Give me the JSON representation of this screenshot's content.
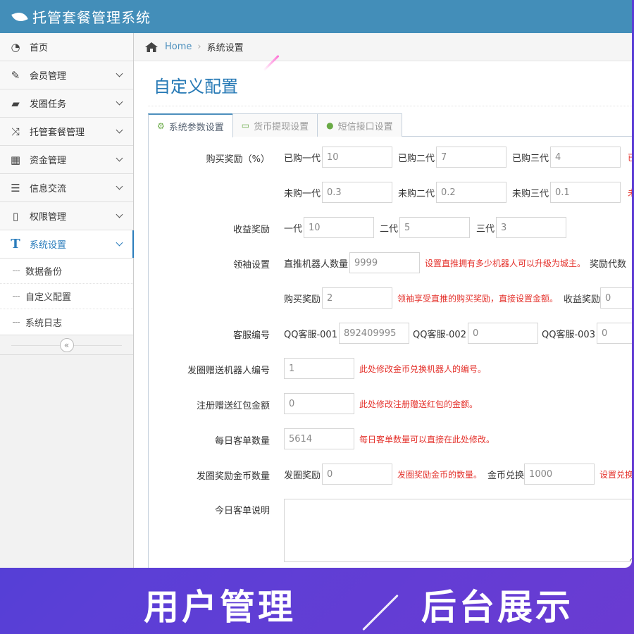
{
  "app": {
    "title": "托管套餐管理系统"
  },
  "sidebar": {
    "items": [
      {
        "label": "首页",
        "icon": "dashboard-icon",
        "glyph": "◔"
      },
      {
        "label": "会员管理",
        "icon": "edit-icon",
        "glyph": "✎"
      },
      {
        "label": "发圈任务",
        "icon": "book-icon",
        "glyph": "▰"
      },
      {
        "label": "托管套餐管理",
        "icon": "shuffle-icon",
        "glyph": "⤨"
      },
      {
        "label": "资金管理",
        "icon": "calendar-icon",
        "glyph": "▦"
      },
      {
        "label": "信息交流",
        "icon": "list-icon",
        "glyph": "☰"
      },
      {
        "label": "权限管理",
        "icon": "file-icon",
        "glyph": "▯"
      },
      {
        "label": "系统设置",
        "icon": "text-icon",
        "glyph": "T"
      }
    ],
    "sub_items": [
      "数据备份",
      "自定义配置",
      "系统日志"
    ],
    "collapse_glyph": "«"
  },
  "breadcrumb": {
    "home": "Home",
    "sep": "›",
    "current": "系统设置"
  },
  "page": {
    "title": "自定义配置"
  },
  "tabs": [
    {
      "label": "系统参数设置",
      "glyph": "⚙"
    },
    {
      "label": "货币提现设置",
      "glyph": "▭"
    },
    {
      "label": "短信接口设置",
      "glyph": "●"
    }
  ],
  "form": {
    "buy_reward": {
      "label": "购买奖励（%）",
      "bought": [
        {
          "prefix": "已购一代",
          "value": "10"
        },
        {
          "prefix": "已购二代",
          "value": "7"
        },
        {
          "prefix": "已购三代",
          "value": "4"
        }
      ],
      "not_bought": [
        {
          "prefix": "未购一代",
          "value": "0.3"
        },
        {
          "prefix": "未购二代",
          "value": "0.2"
        },
        {
          "prefix": "未购三代",
          "value": "0.1"
        }
      ],
      "cut_a": "已",
      "cut_b": "未"
    },
    "income_reward": {
      "label": "收益奖励",
      "gens": [
        {
          "prefix": "一代",
          "value": "10"
        },
        {
          "prefix": "二代",
          "value": "5"
        },
        {
          "prefix": "三代",
          "value": "3"
        }
      ]
    },
    "leader": {
      "label": "领袖设置",
      "robots_prefix": "直推机器人数量",
      "robots_value": "9999",
      "robots_hint": "设置直推拥有多少机器人可以升级为城主。",
      "reward_gen_cut": "奖励代数",
      "buy_prefix": "购买奖励",
      "buy_value": "2",
      "buy_hint": "领袖享受直推的购买奖励，直接设置金额。",
      "income_prefix": "收益奖励",
      "income_value": "0"
    },
    "service": {
      "label": "客服编号",
      "items": [
        {
          "prefix": "QQ客服-001",
          "value": "892409995"
        },
        {
          "prefix": "QQ客服-002",
          "value": "0"
        },
        {
          "prefix": "QQ客服-003",
          "value": "0"
        }
      ]
    },
    "robot_no": {
      "label": "发圈赠送机器人编号",
      "value": "1",
      "hint": "此处修改金币兑换机器人的编号。"
    },
    "red_packet": {
      "label": "注册赠送红包金额",
      "value": "0",
      "hint": "此处修改注册赠送红包的金额。"
    },
    "daily_orders": {
      "label": "每日客单数量",
      "value": "5614",
      "hint": "每日客单数量可以直接在此处修改。"
    },
    "circle_coins": {
      "label": "发圈奖励金币数量",
      "prefix": "发圈奖励",
      "value": "0",
      "hint": "发圈奖励金币的数量。",
      "exchange_prefix": "金币兑换",
      "exchange_value": "1000",
      "exchange_hint_cut": "设置兑换"
    },
    "today_desc": {
      "label": "今日客单说明"
    }
  },
  "banner": {
    "left": "用户管理",
    "right": "后台展示"
  },
  "colors": {
    "header": "#438eb9",
    "accent": "#2b7dbc",
    "hint": "#e4312b"
  }
}
